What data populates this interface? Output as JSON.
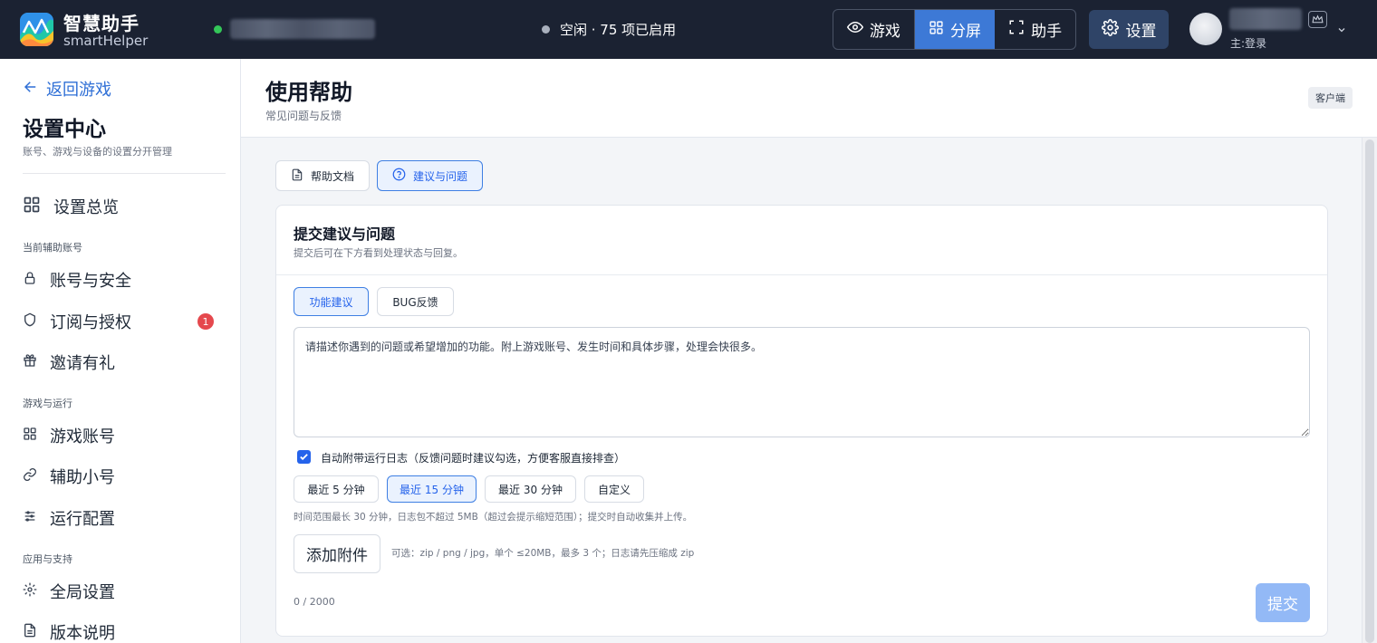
{
  "app": {
    "name": "智慧助手",
    "subtitle": "smartHelper"
  },
  "status": {
    "text": "空闲 · 75 项已启用"
  },
  "modes": [
    {
      "label": "游戏",
      "icon": "eye-icon",
      "active": false
    },
    {
      "label": "分屏",
      "icon": "grid-icon",
      "active": true
    },
    {
      "label": "助手",
      "icon": "fullscreen-icon",
      "active": false
    }
  ],
  "settings_button": {
    "label": "设置",
    "icon": "gear-icon"
  },
  "user": {
    "role": "主:登录"
  },
  "sidebar": {
    "back_label": "返回游戏",
    "title": "设置中心",
    "subtitle": "账号、游戏与设备的设置分开管理",
    "overview": "设置总览",
    "sections": [
      {
        "title": "当前辅助账号",
        "items": [
          {
            "label": "账号与安全",
            "icon": "lock-icon"
          },
          {
            "label": "订阅与授权",
            "icon": "shield-icon",
            "badge": "1"
          },
          {
            "label": "邀请有礼",
            "icon": "gift-icon"
          }
        ]
      },
      {
        "title": "游戏与运行",
        "items": [
          {
            "label": "游戏账号",
            "icon": "grid-icon"
          },
          {
            "label": "辅助小号",
            "icon": "link-icon"
          },
          {
            "label": "运行配置",
            "icon": "sliders-icon"
          }
        ]
      },
      {
        "title": "应用与支持",
        "items": [
          {
            "label": "全局设置",
            "icon": "gear-icon"
          },
          {
            "label": "版本说明",
            "icon": "document-icon"
          }
        ]
      }
    ]
  },
  "page": {
    "title": "使用帮助",
    "subtitle": "常见问题与反馈",
    "tag": "客户端"
  },
  "doc_tabs": [
    {
      "label": "帮助文档",
      "icon": "document-icon",
      "active": false
    },
    {
      "label": "建议与问题",
      "icon": "question-icon",
      "active": true
    }
  ],
  "feedback_card": {
    "title": "提交建议与问题",
    "subtitle": "提交后可在下方看到处理状态与回复。",
    "types": [
      {
        "label": "功能建议",
        "active": true
      },
      {
        "label": "BUG反馈",
        "active": false
      }
    ],
    "textarea": {
      "value": "",
      "placeholder": "请描述你遇到的问题或希望增加的功能。附上游戏账号、发生时间和具体步骤，处理会快很多。"
    },
    "attach_log": {
      "label": "自动附带运行日志（反馈问题时建议勾选，方便客服直接排查）",
      "checked": true
    },
    "ranges": [
      {
        "label": "最近 5 分钟",
        "active": false
      },
      {
        "label": "最近 15 分钟",
        "active": true
      },
      {
        "label": "最近 30 分钟",
        "active": false
      },
      {
        "label": "自定义",
        "active": false
      }
    ],
    "range_hint": "时间范围最长 30 分钟，日志包不超过 5MB（超过会提示缩短范围）；提交时自动收集并上传。",
    "attach_button": "添加附件",
    "attach_hint": "可选：zip / png / jpg，单个 ≤20MB，最多 3 个；日志请先压缩成 zip",
    "char_count": "0 / 2000",
    "submit_label": "提交"
  },
  "colors": {
    "accent": "#2563eb",
    "topbar": "#1b2232",
    "badge": "#e5484d",
    "submit_disabled": "#93b9f6"
  }
}
